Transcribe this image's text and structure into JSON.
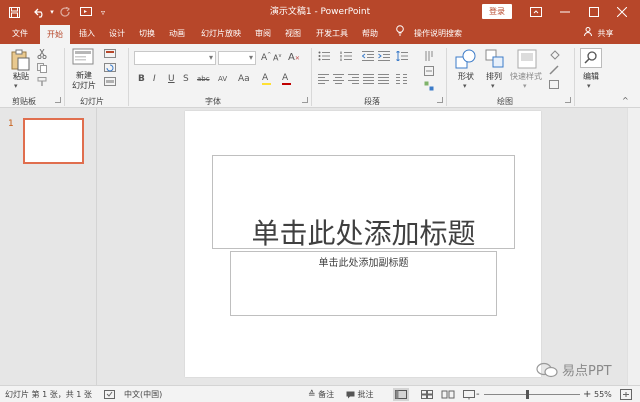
{
  "titlebar": {
    "title": "演示文稿1  -  PowerPoint",
    "login": "登录",
    "icons": [
      "save-icon",
      "undo-icon",
      "redo-icon",
      "start-from-beginning-icon",
      "customize-qat-icon",
      "ribbon-display-icon",
      "minimize-icon",
      "restore-icon",
      "close-icon"
    ]
  },
  "tabs": [
    {
      "label": "文件"
    },
    {
      "label": "开始",
      "active": true
    },
    {
      "label": "插入"
    },
    {
      "label": "设计"
    },
    {
      "label": "切换"
    },
    {
      "label": "动画"
    },
    {
      "label": "幻灯片放映"
    },
    {
      "label": "审阅"
    },
    {
      "label": "视图"
    },
    {
      "label": "开发工具"
    },
    {
      "label": "帮助"
    },
    {
      "label": "操作说明搜索"
    }
  ],
  "share": "共享",
  "ribbon": {
    "paste": "粘贴",
    "new_slide_line1": "新建",
    "new_slide_line2": "幻灯片",
    "shapes": "形状",
    "arrange": "排列",
    "quick_styles": "快速样式",
    "edit": "编辑",
    "groups": {
      "clipboard": "剪贴板",
      "slides": "幻灯片",
      "font": "字体",
      "paragraph": "段落",
      "drawing": "绘图"
    },
    "font_buttons": [
      "B",
      "I",
      "U",
      "S",
      "abc",
      "AV",
      "Aa",
      "A",
      "A"
    ]
  },
  "thumbnails": [
    {
      "number": "1"
    }
  ],
  "slide": {
    "title_placeholder": "单击此处添加标题",
    "subtitle_placeholder": "单击此处添加副标题"
  },
  "watermark": "易点PPT",
  "statusbar": {
    "slide_info": "幻灯片 第 1 张，共 1 张",
    "language": "中文(中国)",
    "notes": "备注",
    "comments": "批注",
    "zoom": "55%"
  },
  "colors": {
    "accent": "#b7472a",
    "thumb_border": "#e06e4e"
  }
}
